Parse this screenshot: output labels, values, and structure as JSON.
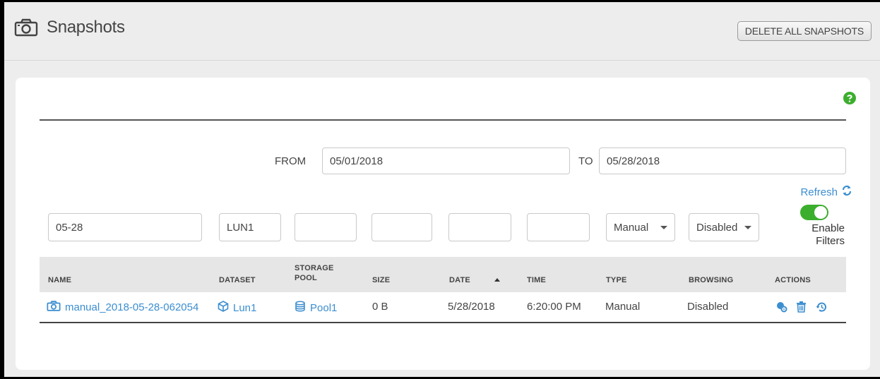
{
  "header": {
    "title": "Snapshots",
    "delete_all_label": "DELETE ALL SNAPSHOTS"
  },
  "date_range": {
    "from_label": "FROM",
    "from_value": "05/01/2018",
    "to_label": "TO",
    "to_value": "05/28/2018"
  },
  "refresh_label": "Refresh",
  "filters": {
    "name": "05-28",
    "dataset": "LUN1",
    "storage_pool": "",
    "size": "",
    "date": "",
    "time": "",
    "type": "Manual",
    "browsing": "Disabled",
    "enable_filters_label_1": "Enable",
    "enable_filters_label_2": "Filters",
    "enabled": true
  },
  "table": {
    "headers": {
      "name": "NAME",
      "dataset": "DATASET",
      "storage_pool_1": "STORAGE",
      "storage_pool_2": "POOL",
      "size": "SIZE",
      "date": "DATE",
      "time": "TIME",
      "type": "TYPE",
      "browsing": "BROWSING",
      "actions": "ACTIONS"
    },
    "rows": [
      {
        "name": "manual_2018-05-28-062054",
        "dataset": "Lun1",
        "storage_pool": "Pool1",
        "size": "0 B",
        "date": "5/28/2018",
        "time": "6:20:00 PM",
        "type": "Manual",
        "browsing": "Disabled"
      }
    ]
  },
  "colors": {
    "accent": "#3b8ed0",
    "toggle_on": "#3cae2e",
    "help": "#3cae2e"
  },
  "icons": [
    "camera-icon",
    "help-icon",
    "refresh-icon",
    "cube-icon",
    "database-icon",
    "clone-settings-icon",
    "trash-icon",
    "restore-icon"
  ]
}
